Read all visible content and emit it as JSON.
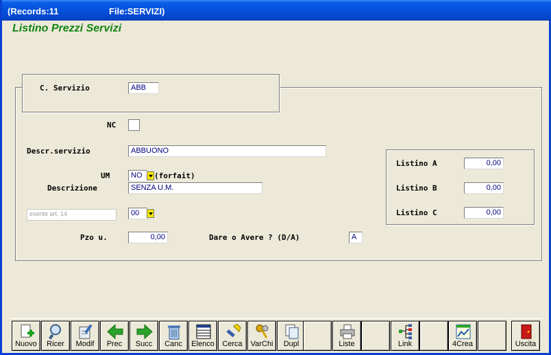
{
  "window": {
    "records_label": "(Records:11",
    "file_label": "File:SERVIZI)"
  },
  "form": {
    "title": "Listino Prezzi Servizi",
    "codice_label": "C. Servizio",
    "codice_value": "ABB",
    "nc_label": "NC",
    "descr_label": "Descr.servizio",
    "descr_value": "ABBUONO",
    "um_label": "UM",
    "um_value": "NO",
    "um_hint": "(forfait)",
    "descrizione_label": "Descrizione",
    "descrizione_value": "SENZA U.M.",
    "iva_desc_value": "esente art. 14",
    "iva_code_value": "00",
    "pzo_label": "Pzo u.",
    "pzo_value": "0,00",
    "dare_avere_label": "Dare o Avere ? (D/A)",
    "dare_avere_value": "A",
    "listino_a_label": "Listino A",
    "listino_a_value": "0,00",
    "listino_b_label": "Listino B",
    "listino_b_value": "0,00",
    "listino_c_label": "Listino C",
    "listino_c_value": "0,00"
  },
  "toolbar": {
    "buttons": [
      {
        "label": "Nuovo",
        "icon": "new-document-plus-icon"
      },
      {
        "label": "Ricer",
        "icon": "magnifier-icon"
      },
      {
        "label": "Modif",
        "icon": "edit-document-icon"
      },
      {
        "label": "Prec",
        "icon": "arrow-left-icon"
      },
      {
        "label": "Succ",
        "icon": "arrow-right-icon"
      },
      {
        "label": "Canc",
        "icon": "trash-icon"
      },
      {
        "label": "Elenco",
        "icon": "list-table-icon"
      },
      {
        "label": "Cerca",
        "icon": "flashlight-icon"
      },
      {
        "label": "VarChi",
        "icon": "keys-icon"
      },
      {
        "label": "Dupl",
        "icon": "duplicate-icon"
      },
      {
        "label": "",
        "icon": ""
      },
      {
        "label": "Liste",
        "icon": "printer-icon"
      },
      {
        "label": "",
        "icon": ""
      },
      {
        "label": "Link",
        "icon": "link-tree-icon"
      },
      {
        "label": "",
        "icon": ""
      },
      {
        "label": "4Crea",
        "icon": "chart-icon"
      },
      {
        "label": "",
        "icon": ""
      },
      {
        "label": "Uscita",
        "icon": "exit-door-icon"
      }
    ]
  },
  "colors": {
    "title_bar": "#0550dc",
    "form_title": "#138513",
    "field_text": "#00007f",
    "dropdown": "#f5e600"
  }
}
